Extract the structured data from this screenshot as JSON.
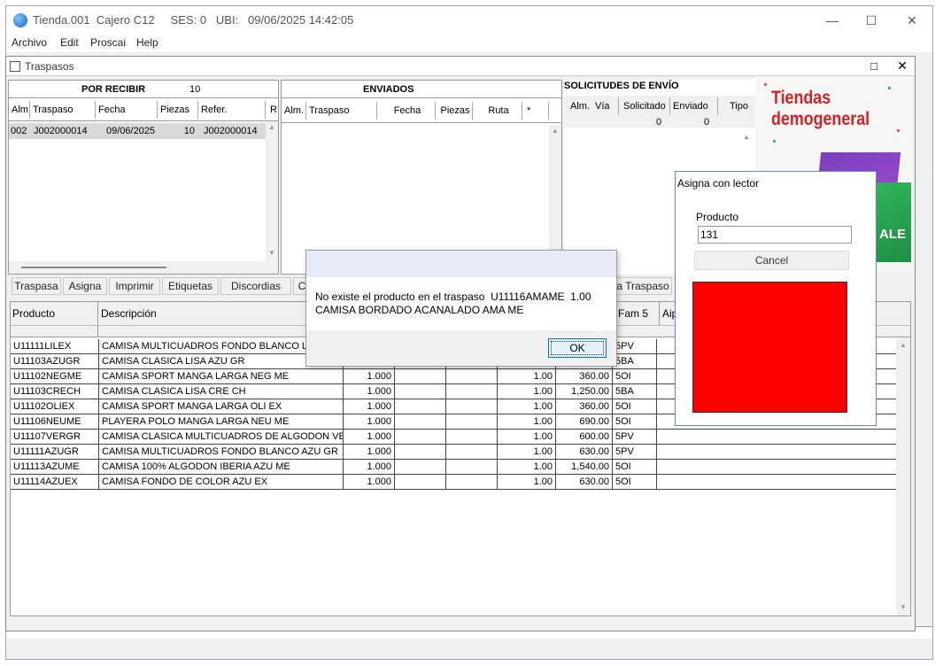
{
  "app": {
    "title": "Tienda.001  Cajero C12     SES: 0   UBI:   09/06/2025 14:42:05",
    "menu": [
      "Archivo",
      "Edit",
      "Proscai",
      "Help"
    ]
  },
  "traspasos": {
    "title": "Traspasos",
    "por_recibir": {
      "label": "POR RECIBIR",
      "count": "10",
      "columns": [
        "Alm",
        "Traspaso",
        "Fecha",
        "Piezas",
        "Refer.",
        "R"
      ],
      "rows": [
        {
          "alm": "002",
          "traspaso": "J002000014",
          "fecha": "09/06/2025",
          "piezas": "10",
          "refer": "J002000014"
        }
      ]
    },
    "enviados": {
      "label": "ENVIADOS",
      "columns": [
        "Alm.",
        "Traspaso",
        "Fecha",
        "Piezas",
        "Ruta",
        "*"
      ]
    },
    "solicitudes": {
      "label": "SOLICITUDES DE ENVÍO",
      "columns": [
        "Alm.",
        "Vía",
        "Solicitado",
        "Enviado",
        "Tipo"
      ],
      "totals": [
        "0",
        "0"
      ]
    },
    "banner": {
      "line1": "Tiendas",
      "line2": "demogeneral",
      "sale": "ALE"
    },
    "buttons": [
      "Traspasa",
      "Asigna",
      "Imprimir",
      "Etiquetas",
      "Discordias",
      "C"
    ],
    "right_button": "a Traspaso",
    "detail": {
      "columns": [
        "Producto",
        "Descripción",
        "Fam 5",
        "Aip"
      ],
      "rows": [
        {
          "producto": "U11111LILEX",
          "descripcion": "CAMISA MULTICUADROS FONDO BLANCO LIL",
          "cant": "",
          "pres": "",
          "precio": "",
          "fam": "5PV"
        },
        {
          "producto": "U11103AZUGR",
          "descripcion": "CAMISA CLASICA LISA AZU GR",
          "cant": "",
          "pres": "",
          "precio": "",
          "fam": "5BA"
        },
        {
          "producto": "U11102NEGME",
          "descripcion": "CAMISA SPORT MANGA LARGA NEG ME",
          "cant": "1.000",
          "pres": "1.00",
          "precio": "360.00",
          "fam": "5OI"
        },
        {
          "producto": "U11103CRECH",
          "descripcion": "CAMISA CLASICA LISA CRE CH",
          "cant": "1.000",
          "pres": "1.00",
          "precio": "1,250.00",
          "fam": "5BA"
        },
        {
          "producto": "U11102OLIEX",
          "descripcion": "CAMISA SPORT MANGA LARGA OLI EX",
          "cant": "1.000",
          "pres": "1.00",
          "precio": "360.00",
          "fam": "5OI"
        },
        {
          "producto": "U11106NEUME",
          "descripcion": "PLAYERA POLO MANGA LARGA NEU ME",
          "cant": "1.000",
          "pres": "1.00",
          "precio": "690.00",
          "fam": "5OI"
        },
        {
          "producto": "U11107VERGR",
          "descripcion": "CAMISA CLASICA MULTICUADROS DE ALGODON VER",
          "cant": "1.000",
          "pres": "1.00",
          "precio": "600.00",
          "fam": "5PV"
        },
        {
          "producto": "U11111AZUGR",
          "descripcion": "CAMISA MULTICUADROS FONDO BLANCO AZU GR",
          "cant": "1.000",
          "pres": "1.00",
          "precio": "630.00",
          "fam": "5PV"
        },
        {
          "producto": "U11113AZUME",
          "descripcion": "CAMISA 100% ALGODON IBERIA AZU ME",
          "cant": "1.000",
          "pres": "1.00",
          "precio": "1,540.00",
          "fam": "5OI"
        },
        {
          "producto": "U11114AZUEX",
          "descripcion": "CAMISA FONDO DE COLOR AZU EX",
          "cant": "1.000",
          "pres": "1.00",
          "precio": "630.00",
          "fam": "5OI"
        }
      ]
    }
  },
  "message_dialog": {
    "line1": "No existe el producto en el traspaso  U11116AMAME  1.00",
    "line2": "CAMISA BORDADO ACANALADO AMA ME",
    "ok_label": "OK"
  },
  "lector_dialog": {
    "title": "Asigna con lector",
    "producto_label": "Producto",
    "producto_value": "131",
    "cancel_label": "Cancel",
    "status_color": "#ff0000"
  },
  "colors": {
    "accent": "#0078d7",
    "banner_red": "#d2232a",
    "status": "#ff0000"
  },
  "icons": [
    "app-globe-icon",
    "minimize-icon",
    "maximize-icon",
    "close-icon",
    "window-icon"
  ]
}
